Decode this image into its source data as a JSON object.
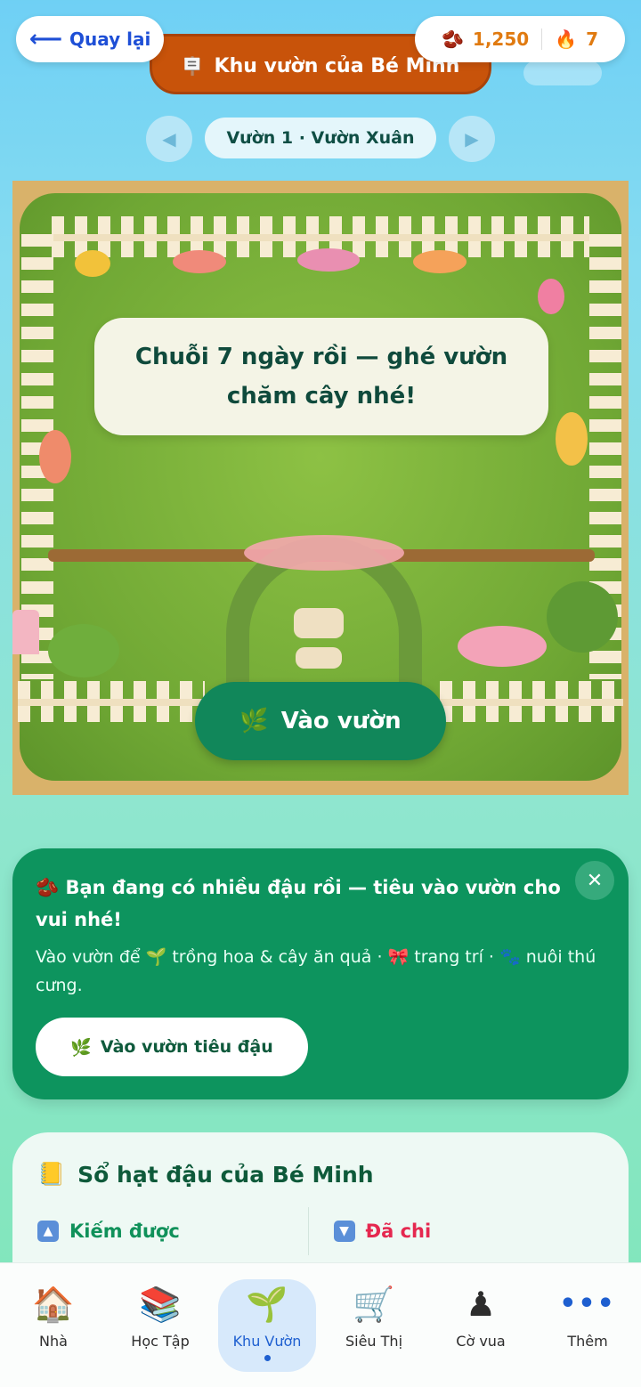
{
  "header": {
    "back_label": "Quay lại",
    "title": "Khu vườn của Bé Minh",
    "beans": "1,250",
    "streak": "7"
  },
  "garden_selector": {
    "name": "Vườn 1 · Vườn Xuân"
  },
  "scene": {
    "bubble_text": "Chuỗi 7 ngày rồi — ghé vườn chăm cây nhé!",
    "enter_label": "Vào vườn"
  },
  "promo": {
    "headline": "Bạn đang có nhiều đậu rồi — tiêu vào vườn cho vui nhé!",
    "body_prefix": "Vào vườn để",
    "body_grow": "trồng hoa & cây ăn quả ·",
    "body_decor": "trang trí ·",
    "body_pet": "nuôi thú cưng.",
    "cta_label": "Vào vườn tiêu đậu"
  },
  "ledger": {
    "title": "Sổ hạt đậu của Bé Minh",
    "earned_label": "Kiếm được",
    "spent_label": "Đã chi"
  },
  "bottom_nav": {
    "items": [
      {
        "label": "Nhà"
      },
      {
        "label": "Học Tập"
      },
      {
        "label": "Khu Vườn"
      },
      {
        "label": "Siêu Thị"
      },
      {
        "label": "Cờ vua"
      },
      {
        "label": "Thêm"
      }
    ]
  },
  "colors": {
    "accent_green": "#0d945e",
    "banner_orange": "#c8530a",
    "link_blue": "#1e4fd6",
    "spent_red": "#e5284f"
  }
}
